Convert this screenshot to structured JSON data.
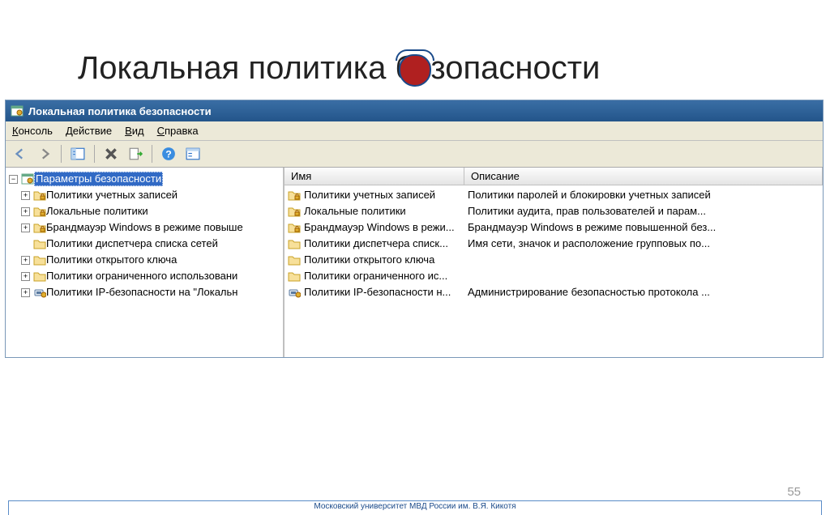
{
  "slide": {
    "title": "Локальная политика безопасности",
    "number": "55",
    "footer": "Московский университет МВД России им. В.Я. Кикотя"
  },
  "window": {
    "title": "Локальная политика безопасности",
    "menu": {
      "console": "Консоль",
      "action": "Действие",
      "view": "Вид",
      "help": "Справка"
    },
    "columns": {
      "name": "Имя",
      "description": "Описание"
    },
    "tree": [
      {
        "level": 0,
        "expander": "minus",
        "icon": "security",
        "label": "Параметры безопасности",
        "selected": true
      },
      {
        "level": 1,
        "expander": "plus",
        "icon": "folder-lock",
        "label": "Политики учетных записей"
      },
      {
        "level": 1,
        "expander": "plus",
        "icon": "folder-lock",
        "label": "Локальные политики"
      },
      {
        "level": 1,
        "expander": "plus",
        "icon": "folder-lock",
        "label": "Брандмауэр Windows в режиме повыше"
      },
      {
        "level": 1,
        "expander": "none",
        "icon": "folder",
        "label": "Политики диспетчера списка сетей"
      },
      {
        "level": 1,
        "expander": "plus",
        "icon": "folder",
        "label": "Политики открытого ключа"
      },
      {
        "level": 1,
        "expander": "plus",
        "icon": "folder",
        "label": "Политики ограниченного использовани"
      },
      {
        "level": 1,
        "expander": "plus",
        "icon": "ipsec",
        "label": "Политики IP-безопасности на \"Локальн"
      }
    ],
    "list": [
      {
        "icon": "folder-lock",
        "name": "Политики учетных записей",
        "desc": "Политики паролей и блокировки учетных записей"
      },
      {
        "icon": "folder-lock",
        "name": "Локальные политики",
        "desc": "Политики аудита, прав пользователей и парам..."
      },
      {
        "icon": "folder-lock",
        "name": "Брандмауэр Windows в режи...",
        "desc": "Брандмауэр Windows в режиме повышенной без..."
      },
      {
        "icon": "folder",
        "name": "Политики диспетчера списк...",
        "desc": "Имя сети, значок и расположение групповых по..."
      },
      {
        "icon": "folder",
        "name": "Политики открытого ключа",
        "desc": ""
      },
      {
        "icon": "folder",
        "name": "Политики ограниченного ис...",
        "desc": ""
      },
      {
        "icon": "ipsec",
        "name": "Политики IP-безопасности н...",
        "desc": "Администрирование безопасностью протокола ..."
      }
    ]
  }
}
